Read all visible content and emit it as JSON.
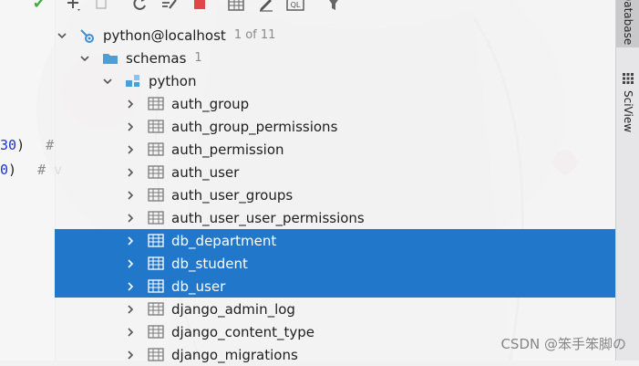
{
  "editor": {
    "lines": [
      {
        "num": "30",
        "punct": ")",
        "comment": "#"
      },
      {
        "num": "0",
        "punct": ")",
        "comment": "# v"
      }
    ]
  },
  "toolbar": {
    "buttons": [
      {
        "name": "add",
        "icon": "plus-icon"
      },
      {
        "name": "duplicate",
        "icon": "copy-icon"
      },
      {
        "name": "refresh",
        "icon": "refresh-icon"
      },
      {
        "name": "sync-schema",
        "icon": "schema-sync-icon"
      },
      {
        "name": "stop",
        "icon": "stop-icon"
      },
      {
        "name": "table-editor",
        "icon": "table-icon"
      },
      {
        "name": "edit",
        "icon": "pencil-icon"
      },
      {
        "name": "query-console",
        "icon": "ql-console-icon",
        "text": "QL"
      },
      {
        "name": "filter",
        "icon": "filter-icon"
      }
    ]
  },
  "tree": {
    "datasource": {
      "label": "python@localhost",
      "count": "1 of 11"
    },
    "schemas": {
      "label": "schemas",
      "count": "1"
    },
    "schema": {
      "label": "python"
    },
    "tables": [
      {
        "label": "auth_group",
        "selected": false
      },
      {
        "label": "auth_group_permissions",
        "selected": false
      },
      {
        "label": "auth_permission",
        "selected": false
      },
      {
        "label": "auth_user",
        "selected": false
      },
      {
        "label": "auth_user_groups",
        "selected": false
      },
      {
        "label": "auth_user_user_permissions",
        "selected": false
      },
      {
        "label": "db_department",
        "selected": true
      },
      {
        "label": "db_student",
        "selected": true
      },
      {
        "label": "db_user",
        "selected": true
      },
      {
        "label": "django_admin_log",
        "selected": false
      },
      {
        "label": "django_content_type",
        "selected": false
      },
      {
        "label": "django_migrations",
        "selected": false
      }
    ]
  },
  "right_strip": {
    "database_tab": "Database",
    "sciview_tab": "SciView"
  },
  "watermark": "CSDN @笨手笨脚の",
  "colors": {
    "selection": "#2177c9",
    "accent_blue": "#3d8fd8"
  }
}
